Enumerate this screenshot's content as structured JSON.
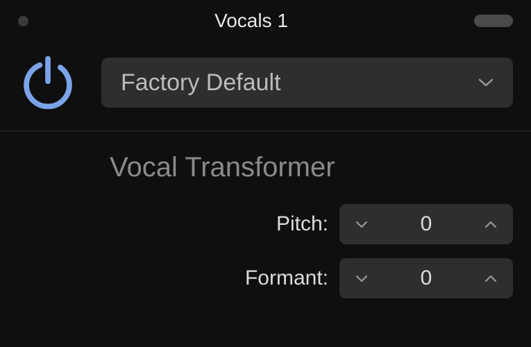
{
  "header": {
    "title": "Vocals 1"
  },
  "preset": {
    "label": "Factory Default"
  },
  "plugin": {
    "title": "Vocal Transformer"
  },
  "params": {
    "pitch": {
      "label": "Pitch:",
      "value": "0"
    },
    "formant": {
      "label": "Formant:",
      "value": "0"
    }
  }
}
